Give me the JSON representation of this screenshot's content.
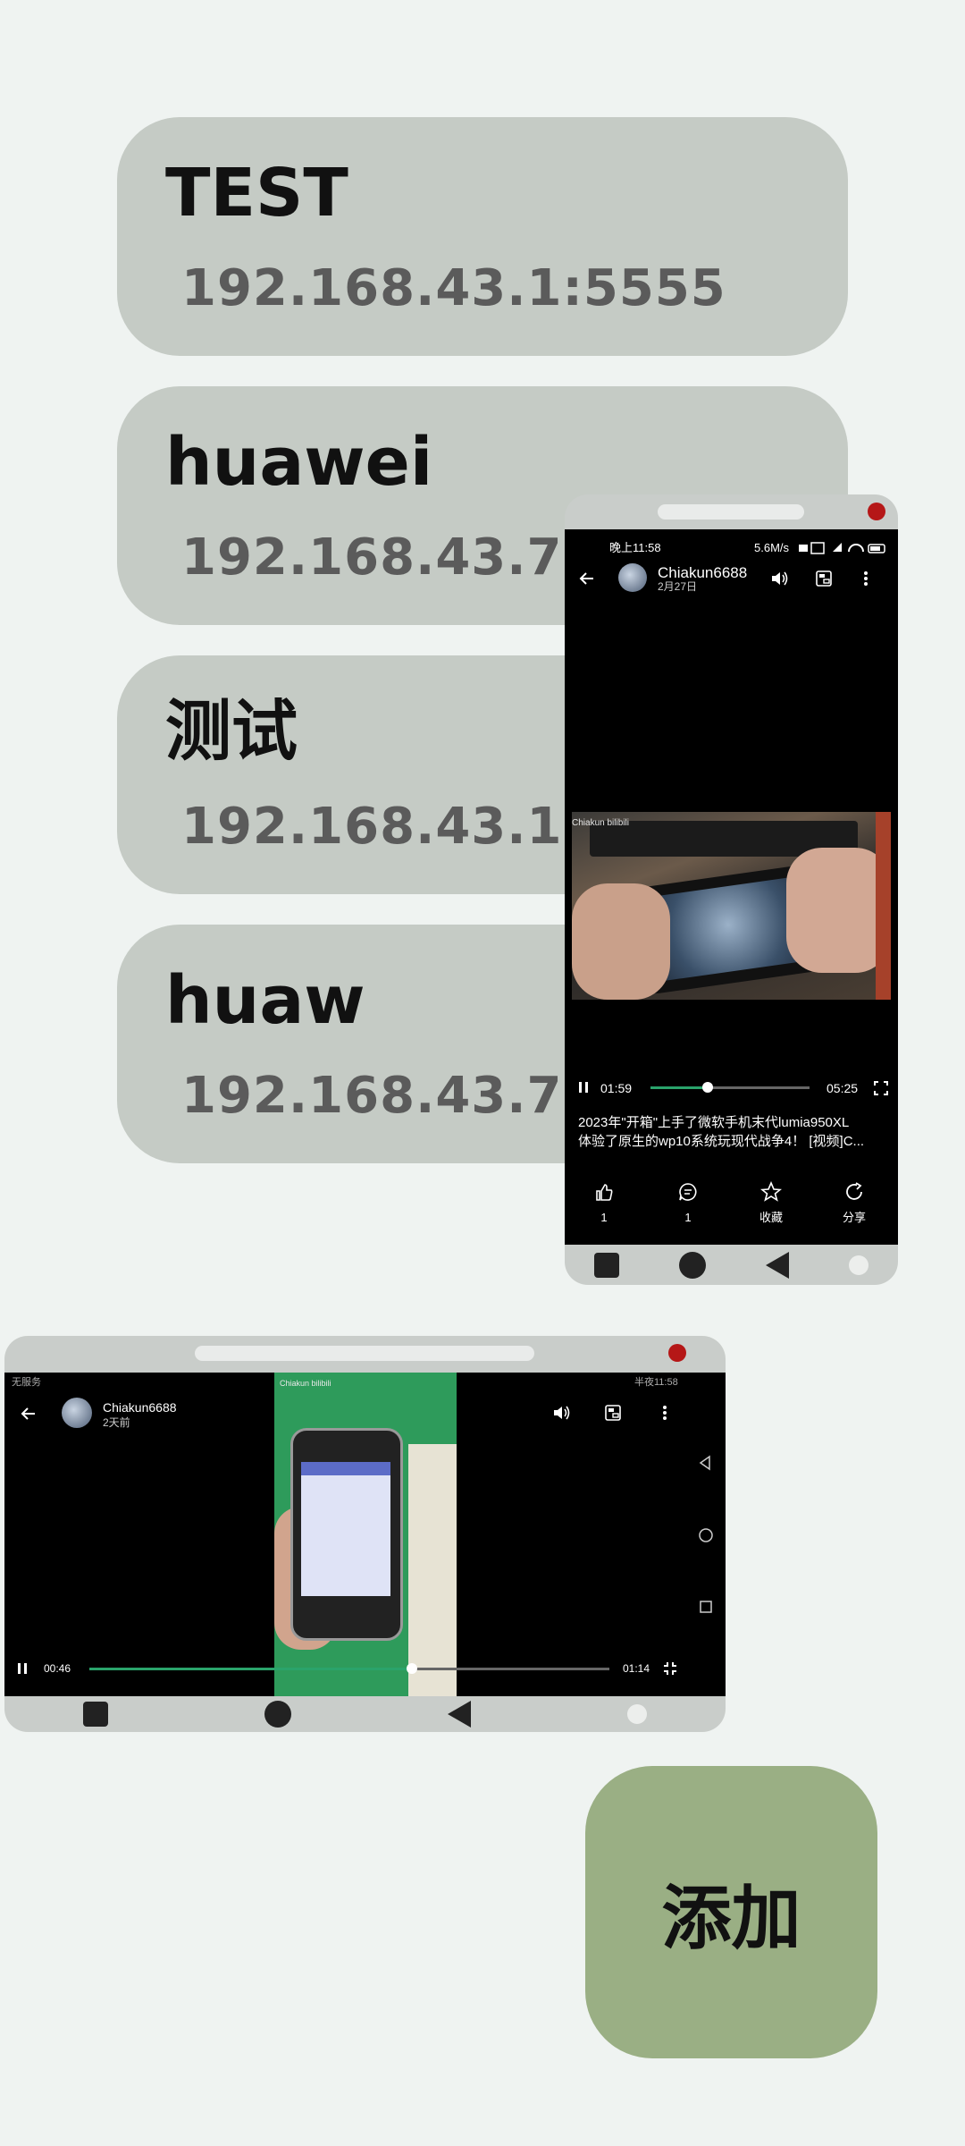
{
  "devices": [
    {
      "name": "TEST",
      "address": "192.168.43.1:5555"
    },
    {
      "name": "huawei",
      "address": "192.168.43.70:5555"
    },
    {
      "name": "测试",
      "address": "192.168.43.1:5555"
    },
    {
      "name": "huaw",
      "address": "192.168.43.70:5555"
    }
  ],
  "portrait": {
    "status_time": "晚上11:58",
    "status_speed": "5.6M/s",
    "uploader": "Chiakun6688",
    "upload_date": "2月27日",
    "watermark": "Chiakun bilibili",
    "current_time": "01:59",
    "duration": "05:25",
    "progress": 0.36,
    "title_line1": "2023年\"开箱\"上手了微软手机末代lumia950XL",
    "title_line2": "体验了原生的wp10系统玩现代战争4！ [视频]C...",
    "actions": [
      {
        "icon": "thumbs-up-icon",
        "label": "1"
      },
      {
        "icon": "comment-icon",
        "label": "1"
      },
      {
        "icon": "star-icon",
        "label": "收藏"
      },
      {
        "icon": "share-icon",
        "label": "分享"
      }
    ]
  },
  "landscape": {
    "status_left": "无服务",
    "status_right": "半夜11:58",
    "uploader": "Chiakun6688",
    "upload_date": "2天前",
    "watermark": "Chiakun bilibili",
    "current_time": "00:46",
    "duration": "01:14",
    "progress": 0.62
  },
  "add_button": "添加",
  "colors": {
    "background": "#eff3f1",
    "card": "#c5cbc5",
    "add_button": "#9aaf84",
    "progress": "#2aa36b",
    "close_dot": "#b51717"
  }
}
